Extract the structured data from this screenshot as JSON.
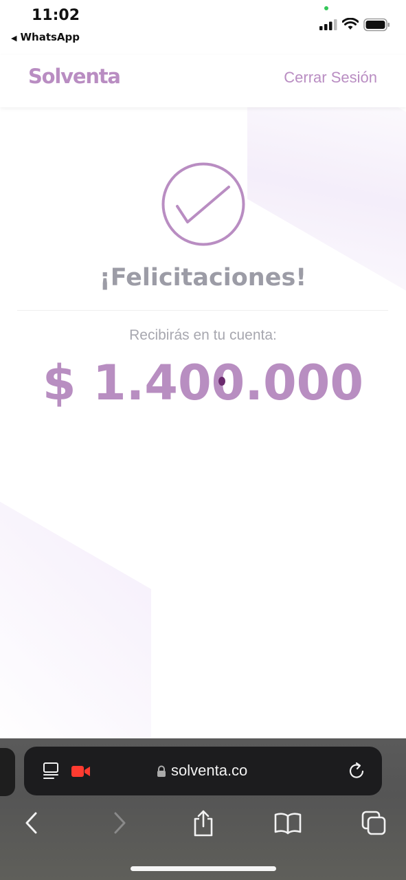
{
  "status_bar": {
    "time": "11:02",
    "back_app": "WhatsApp"
  },
  "header": {
    "brand": "Solventa",
    "logout_label": "Cerrar Sesión"
  },
  "main": {
    "title": "¡Felicitaciones!",
    "receive_label": "Recibirás en tu cuenta:",
    "amount": "$ 1.400.000"
  },
  "browser": {
    "url": "solventa.co"
  },
  "colors": {
    "brand": "#b98dc2",
    "title_gray": "#9c9ca6",
    "record_red": "#ff3b30"
  }
}
